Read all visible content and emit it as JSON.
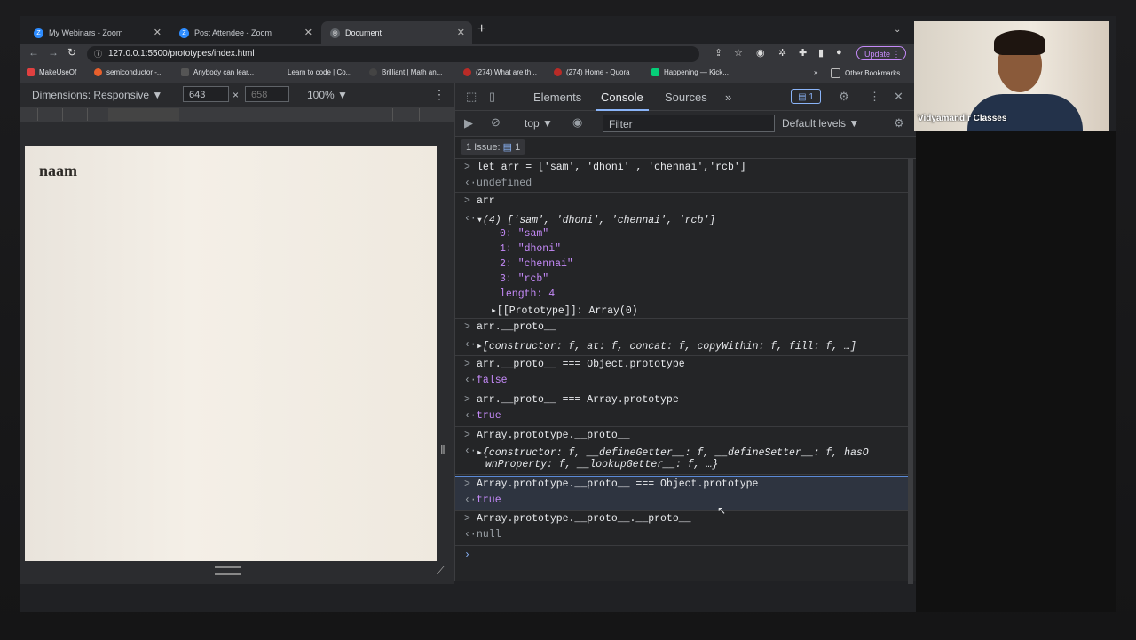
{
  "browser": {
    "tabs": [
      {
        "title": "My Webinars - Zoom"
      },
      {
        "title": "Post Attendee - Zoom"
      },
      {
        "title": "Document"
      }
    ],
    "url": "127.0.0.1:5500/prototypes/index.html",
    "update_label": "Update",
    "bookmarks": [
      {
        "label": "MakeUseOf"
      },
      {
        "label": "semiconductor -..."
      },
      {
        "label": "Anybody can lear..."
      },
      {
        "label": "Learn to code | Co..."
      },
      {
        "label": "Brilliant | Math an..."
      },
      {
        "label": "(274) What are th..."
      },
      {
        "label": "(274) Home - Quora"
      },
      {
        "label": "Happening — Kick..."
      }
    ],
    "other_bookmarks": "Other Bookmarks"
  },
  "device_toolbar": {
    "dimensions_label": "Dimensions: Responsive ▼",
    "width": "643",
    "height": "658",
    "zoom": "100% ▼"
  },
  "page": {
    "heading": "naam"
  },
  "devtools": {
    "tabs": [
      "Elements",
      "Console",
      "Sources"
    ],
    "active_tab": "Console",
    "badge": "1",
    "context": "top ▼",
    "filter_placeholder": "Filter",
    "levels": "Default levels ▼",
    "issues": "1 Issue:",
    "issues_count": "1"
  },
  "console": [
    {
      "type": "in",
      "text": "let arr = ['sam', 'dhoni' , 'chennai','rcb']"
    },
    {
      "type": "out",
      "text": "undefined"
    },
    {
      "type": "in",
      "text": "arr"
    },
    {
      "type": "out",
      "text": "▾(4) ['sam', 'dhoni', 'chennai', 'rcb']"
    },
    {
      "type": "child",
      "text": "0: \"sam\""
    },
    {
      "type": "child",
      "text": "1: \"dhoni\""
    },
    {
      "type": "child",
      "text": "2: \"chennai\""
    },
    {
      "type": "child",
      "text": "3: \"rcb\""
    },
    {
      "type": "child",
      "text": "length: 4"
    },
    {
      "type": "child",
      "text": "▸[[Prototype]]: Array(0)"
    },
    {
      "type": "in",
      "text": "arr.__proto__"
    },
    {
      "type": "out",
      "text": "▸[constructor: f, at: f, concat: f, copyWithin: f, fill: f, …]"
    },
    {
      "type": "in",
      "text": "arr.__proto__ === Object.prototype"
    },
    {
      "type": "out",
      "text": "false"
    },
    {
      "type": "in",
      "text": "arr.__proto__ === Array.prototype"
    },
    {
      "type": "out",
      "text": "true"
    },
    {
      "type": "in",
      "text": "Array.prototype.__proto__"
    },
    {
      "type": "out",
      "text": "▸{constructor: f, __defineGetter__: f, __defineSetter__: f, hasO"
    },
    {
      "type": "cont",
      "text": "wnProperty: f, __lookupGetter__: f, …}"
    },
    {
      "type": "in",
      "text": "Array.prototype.__proto__ === Object.prototype"
    },
    {
      "type": "out",
      "text": "true"
    },
    {
      "type": "in",
      "text": "Array.prototype.__proto__.__proto__"
    },
    {
      "type": "out",
      "text": "null"
    }
  ],
  "video": {
    "name": "Vidyamandir Classes"
  }
}
